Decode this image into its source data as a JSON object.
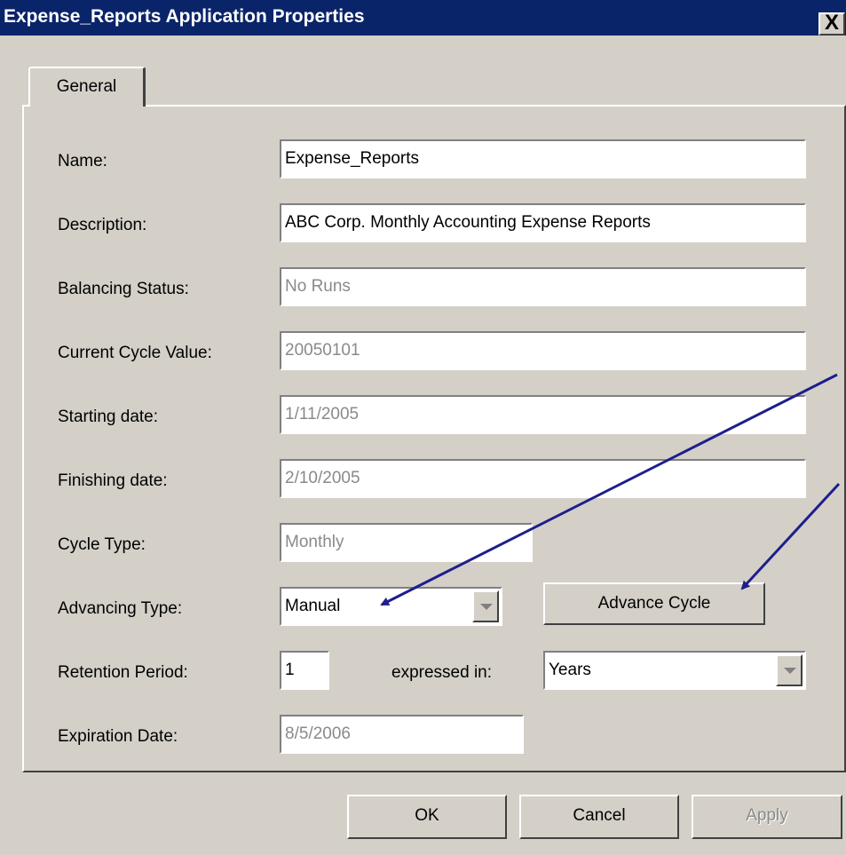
{
  "window": {
    "title": "Expense_Reports Application Properties",
    "close_symbol": "X"
  },
  "tabs": [
    {
      "label": "General"
    }
  ],
  "fields": {
    "name": {
      "label": "Name:",
      "value": "Expense_Reports"
    },
    "description": {
      "label": "Description:",
      "value": "ABC Corp. Monthly Accounting Expense Reports"
    },
    "balancing_status": {
      "label": "Balancing Status:",
      "value": "No Runs"
    },
    "current_cycle_value": {
      "label": "Current Cycle Value:",
      "value": "20050101"
    },
    "starting_date": {
      "label": "Starting date:",
      "value": "1/11/2005"
    },
    "finishing_date": {
      "label": "Finishing date:",
      "value": "2/10/2005"
    },
    "cycle_type": {
      "label": "Cycle Type:",
      "value": "Monthly"
    },
    "advancing_type": {
      "label": "Advancing Type:",
      "value": "Manual"
    },
    "retention_period": {
      "label": "Retention Period:",
      "value": "1"
    },
    "expressed_in": {
      "label": "expressed in:",
      "value": "Years"
    },
    "expiration_date": {
      "label": "Expiration Date:",
      "value": "8/5/2006"
    }
  },
  "buttons": {
    "advance_cycle": "Advance Cycle",
    "ok": "OK",
    "cancel": "Cancel",
    "apply": "Apply"
  },
  "colors": {
    "title_bar": "#0a246a",
    "dialog_face": "#d4d0c8",
    "annotation_arrow": "#1e1e8c",
    "disabled_text": "#8a8a8a"
  }
}
